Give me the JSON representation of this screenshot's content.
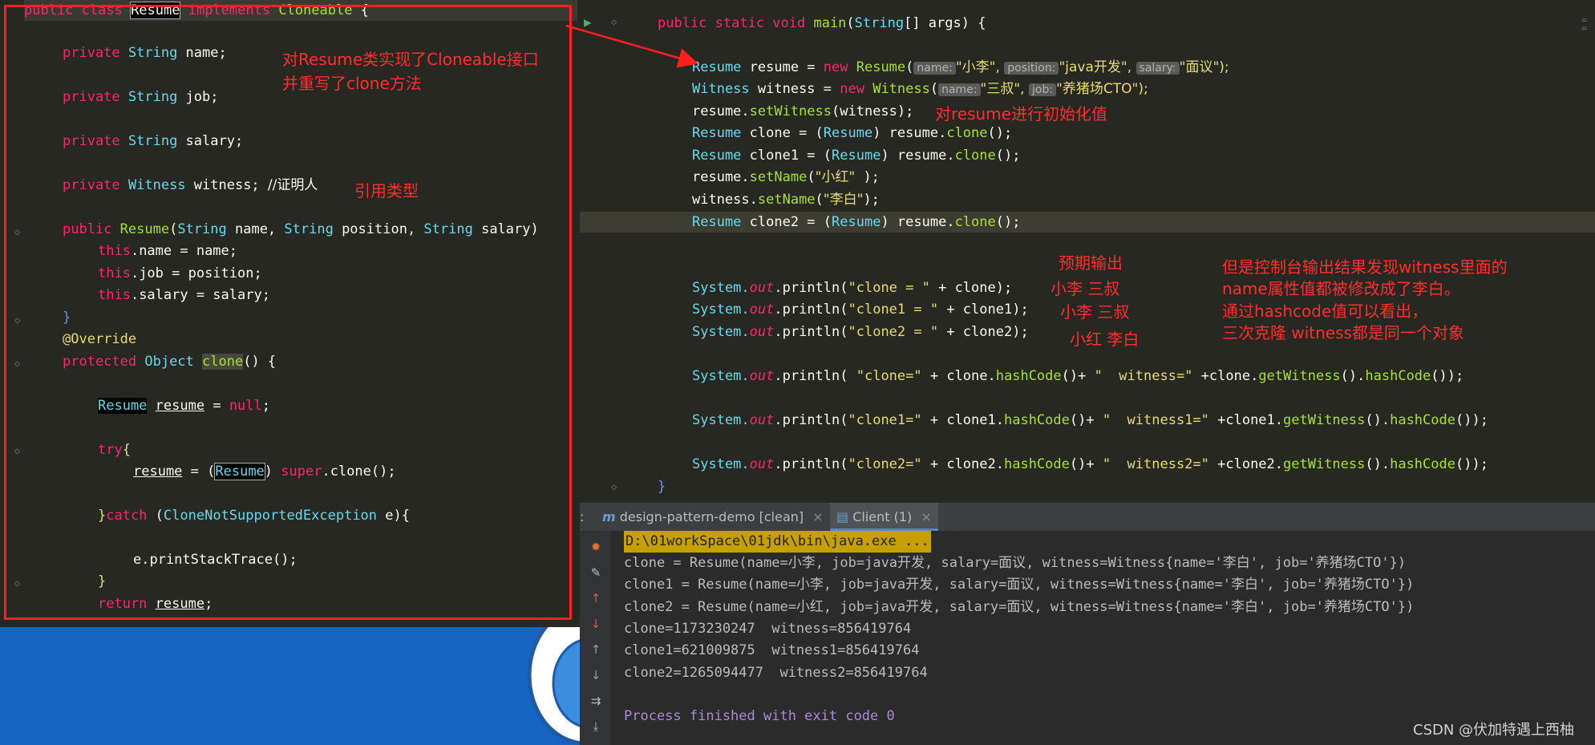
{
  "left_code": {
    "l0": [
      "public class ",
      "Resume",
      " implements ",
      "Cloneable",
      " {"
    ],
    "l1": [
      "private ",
      "String",
      " name;"
    ],
    "l2": [
      "private ",
      "String",
      " job;"
    ],
    "l3": [
      "private ",
      "String",
      " salary;"
    ],
    "l4": [
      "private ",
      "Witness",
      " witness; ",
      "//证明人"
    ],
    "l5": [
      "public ",
      "Resume",
      "(",
      "String",
      " name, ",
      "String",
      " position, ",
      "String",
      " salary)"
    ],
    "l6": [
      "this",
      ".name = name;"
    ],
    "l7": [
      "this",
      ".job = position;"
    ],
    "l8": [
      "this",
      ".salary = salary;"
    ],
    "l9": [
      "}"
    ],
    "l10": [
      "@Override"
    ],
    "l11": [
      "protected ",
      "Object",
      " ",
      "clone",
      "() {"
    ],
    "l12": [
      "Resume",
      " ",
      "resume",
      " = ",
      "null",
      ";"
    ],
    "l13": [
      "try",
      "{"
    ],
    "l14": [
      "resume",
      " = (",
      "Resume",
      ") ",
      "super",
      ".clone();"
    ],
    "l15": [
      "}",
      "catch",
      " (",
      "CloneNotSupportedException",
      " e){"
    ],
    "l16": [
      "e.printStackTrace();"
    ],
    "l17": [
      "}"
    ],
    "l18": [
      "return ",
      "resume",
      ";"
    ]
  },
  "annotations": {
    "a1": "对Resume类实现了Cloneable接口",
    "a2": "并重写了clone方法",
    "a3": "引用类型",
    "a4": "对resume进行初始化值",
    "a5": "预期输出",
    "a6": "小李  三叔",
    "a7": "小李 三叔",
    "a8": "小红 李白",
    "a9": "但是控制台输出结果发现witness里面的",
    "a10": "name属性值都被修改成了李白。",
    "a11": "通过hashcode值可以看出，",
    "a12": "三次克隆 witness都是同一个对象"
  },
  "right_code": {
    "r0": [
      "public static void ",
      "main",
      "(",
      "String",
      "[] args) {"
    ],
    "r1": [
      "Resume",
      " resume = ",
      "new ",
      "Resume",
      "(",
      "name:",
      "\"小李\", ",
      "position:",
      "\"java开发\", ",
      "salary:",
      "\"面议\");"
    ],
    "r2": [
      "Witness",
      " witness = ",
      "new ",
      "Witness",
      "(",
      "name:",
      "\"三叔\", ",
      "job:",
      "\"养猪场CTO\");"
    ],
    "r3": [
      "resume.",
      "setWitness",
      "(witness);"
    ],
    "r4": [
      "Resume",
      " clone = (",
      "Resume",
      ") resume.",
      "clone",
      "();"
    ],
    "r5": [
      "Resume",
      " clone1 = (",
      "Resume",
      ") resume.",
      "clone",
      "();"
    ],
    "r6": [
      "resume.",
      "setName",
      "(",
      "\"小红\"",
      " );"
    ],
    "r7": [
      "witness.",
      "setName",
      "(",
      "\"李白\"",
      ");"
    ],
    "r8": [
      "Resume",
      " clone2 = (",
      "Resume",
      ") resume.",
      "clone",
      "();"
    ],
    "r9": [
      "System.",
      "out",
      ".println(",
      "\"clone = \"",
      " + clone);"
    ],
    "r10": [
      "System.",
      "out",
      ".println(",
      "\"clone1 = \"",
      " + clone1);"
    ],
    "r11": [
      "System.",
      "out",
      ".println(",
      "\"clone2 = \"",
      " + clone2);"
    ],
    "r12": [
      "System.",
      "out",
      ".println( ",
      "\"clone=\"",
      " + clone.",
      "hashCode",
      "()+ ",
      "\"  witness=\"",
      " +clone.",
      "getWitness",
      "().",
      "hashCode",
      "());"
    ],
    "r13": [
      "System.",
      "out",
      ".println(",
      "\"clone1=\"",
      " + clone1.",
      "hashCode",
      "()+ ",
      "\"  witness1=\"",
      " +clone1.",
      "getWitness",
      "().",
      "hashCode",
      "());"
    ],
    "r14": [
      "System.",
      "out",
      ".println(",
      "\"clone2=\"",
      " + clone2.",
      "hashCode",
      "()+ ",
      "\"  witness2=\"",
      " +clone2.",
      "getWitness",
      "().",
      "hashCode",
      "());"
    ],
    "r15": [
      "}"
    ]
  },
  "tabs": {
    "tab1_icon": "m",
    "tab1_label": "design-pattern-demo [clean]",
    "tab2_label": "Client (1)",
    "close": "×",
    "colon": ":"
  },
  "console": {
    "c0": "D:\\01workSpace\\01jdk\\bin\\java.exe ...",
    "c1": "clone = Resume(name=小李, job=java开发, salary=面议, witness=Witness{name='李白', job='养猪场CTO'})",
    "c2": "clone1 = Resume(name=小李, job=java开发, salary=面议, witness=Witness{name='李白', job='养猪场CTO'})",
    "c3": "clone2 = Resume(name=小红, job=java开发, salary=面议, witness=Witness{name='李白', job='养猪场CTO'})",
    "c4": "clone=1173230247  witness=856419764",
    "c5": "clone1=621009875  witness1=856419764",
    "c6": "clone2=1265094477  witness2=856419764",
    "c7": "Process finished with exit code 0"
  },
  "watermark": "CSDN @伏加特遇上西柚",
  "colors": {
    "annotation_red": "#ff2d2d",
    "console_highlight": "#c6a000",
    "process_text": "#a98bd6"
  }
}
